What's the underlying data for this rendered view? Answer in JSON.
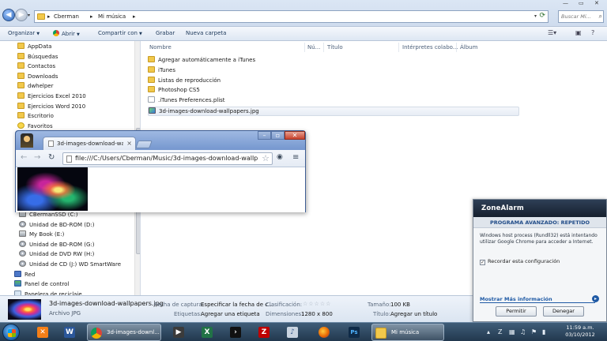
{
  "explorer": {
    "breadcrumb": [
      "Cberman",
      "Mi música"
    ],
    "search_placeholder": "Buscar Mi...",
    "toolbar": {
      "organize": "Organizar",
      "open": "Abrir",
      "share": "Compartir con",
      "burn": "Grabar",
      "new_folder": "Nueva carpeta"
    },
    "nav_items": [
      {
        "label": "AppData",
        "icon": "folder-icon"
      },
      {
        "label": "Búsquedas",
        "icon": "folder-icon"
      },
      {
        "label": "Contactos",
        "icon": "folder-icon"
      },
      {
        "label": "Downloads",
        "icon": "folder-icon"
      },
      {
        "label": "dwhelper",
        "icon": "folder-icon"
      },
      {
        "label": "Ejercicios Excel 2010",
        "icon": "folder-icon"
      },
      {
        "label": "Ejercicios Word 2010",
        "icon": "folder-icon"
      },
      {
        "label": "Escritorio",
        "icon": "folder-icon"
      },
      {
        "label": "Favoritos",
        "icon": "star-icon"
      }
    ],
    "nav_items_lower": [
      {
        "label": "CBermanSSD (C:)",
        "icon": "drive-icon"
      },
      {
        "label": "Unidad de BD-ROM (D:)",
        "icon": "cd-icon"
      },
      {
        "label": "My Book (E:)",
        "icon": "drive-icon"
      },
      {
        "label": "Unidad de BD-ROM (G:)",
        "icon": "cd-icon"
      },
      {
        "label": "Unidad de DVD RW (H:)",
        "icon": "cd-icon"
      },
      {
        "label": "Unidad de CD (J:) WD SmartWare",
        "icon": "cd-icon"
      },
      {
        "label": "Red",
        "icon": "network-icon"
      },
      {
        "label": "Panel de control",
        "icon": "control-panel-icon"
      },
      {
        "label": "Papelera de reciclaje",
        "icon": "recycle-bin-icon"
      }
    ],
    "columns": [
      "Nombre",
      "Nú...",
      "Título",
      "Intérpretes colabo...",
      "Álbum"
    ],
    "files": [
      {
        "name": "Agregar automáticamente a iTunes",
        "icon": "folder-icon"
      },
      {
        "name": "iTunes",
        "icon": "folder-icon"
      },
      {
        "name": "Listas de reproducción",
        "icon": "folder-icon"
      },
      {
        "name": "Photoshop CS5",
        "icon": "folder-icon"
      },
      {
        "name": ".iTunes Preferences.plist",
        "icon": "document-icon"
      },
      {
        "name": "3d-images-download-wallpapers.jpg",
        "icon": "image-icon"
      }
    ],
    "details": {
      "filename": "3d-images-download-wallpapers.jpg",
      "filetype": "Archivo JPG",
      "date_label": "Fecha de captura:",
      "date_value": "Especificar la fecha de c...",
      "tags_label": "Etiquetas:",
      "tags_value": "Agregar una etiqueta",
      "rating_label": "Clasificación:",
      "rating_stars": "☆☆☆☆☆",
      "dimensions_label": "Dimensiones:",
      "dimensions_value": "1280 x 800",
      "size_label": "Tamaño:",
      "size_value": "100 KB",
      "title_label": "Título:",
      "title_value": "Agregar un título"
    }
  },
  "chrome": {
    "tab_title": "3d-images-download-wall",
    "url": "file:///C:/Users/Cberman/Music/3d-images-download-wallp"
  },
  "zonealarm": {
    "brand": "ZoneAlarm",
    "subtitle": "PROGRAMA AVANZADO: REPETIDO",
    "message": "Windows host process (Rundll32) está intentando utilizar Google Chrome para acceder a Internet.",
    "remember": "Recordar esta configuración",
    "more_info": "Mostrar Más información",
    "allow": "Permitir",
    "deny": "Denegar"
  },
  "taskbar": {
    "chrome_label": "3d-images-downl...",
    "explorer_label": "Mi música",
    "clock_time": "11:59 a.m.",
    "clock_date": "03/10/2012"
  }
}
